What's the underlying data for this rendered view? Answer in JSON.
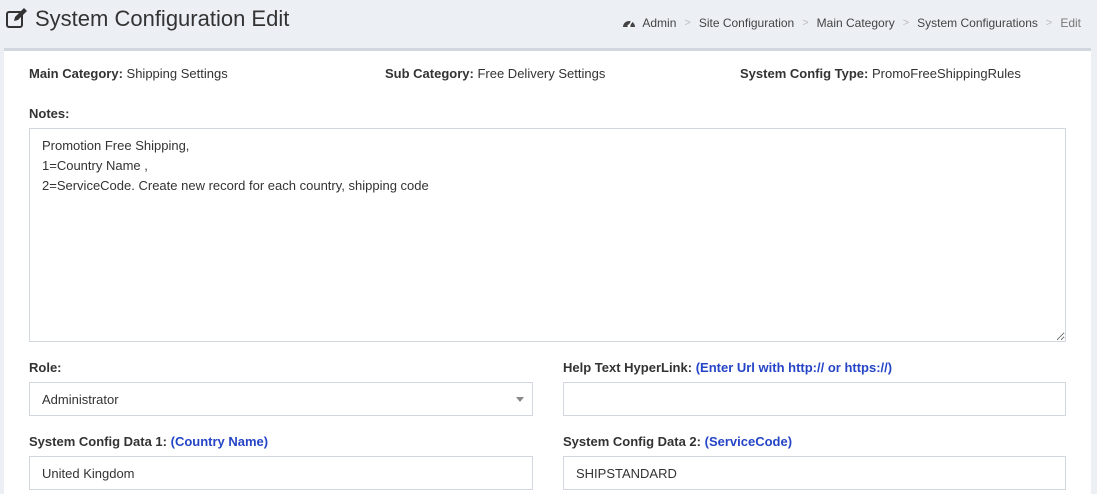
{
  "header": {
    "title": "System Configuration Edit",
    "title_icon": "edit-icon",
    "breadcrumb": [
      {
        "label": "Admin",
        "icon": "dashboard-icon"
      },
      {
        "label": "Site Configuration"
      },
      {
        "label": "Main Category"
      },
      {
        "label": "System Configurations"
      },
      {
        "label": "Edit"
      }
    ],
    "breadcrumb_separator": ">"
  },
  "meta": {
    "main_category_label": "Main Category:",
    "main_category_value": "Shipping Settings",
    "sub_category_label": "Sub Category:",
    "sub_category_value": "Free Delivery Settings",
    "config_type_label": "System Config Type:",
    "config_type_value": "PromoFreeShippingRules"
  },
  "form": {
    "notes_label": "Notes:",
    "notes_value": "Promotion Free Shipping,\n1=Country Name ,\n2=ServiceCode. Create new record for each country, shipping code",
    "role_label": "Role:",
    "role_value": "Administrator",
    "help_label": "Help Text HyperLink:",
    "help_hint": "(Enter Url with http:// or https://)",
    "help_value": "",
    "data1_label": "System Config Data 1:",
    "data1_hint": "(Country Name)",
    "data1_value": "United Kingdom",
    "data2_label": "System Config Data 2:",
    "data2_hint": "(ServiceCode)",
    "data2_value": "SHIPSTANDARD"
  },
  "colors": {
    "background": "#ecf0f5",
    "hint_blue": "#2545c6",
    "border": "#d2d6de"
  }
}
